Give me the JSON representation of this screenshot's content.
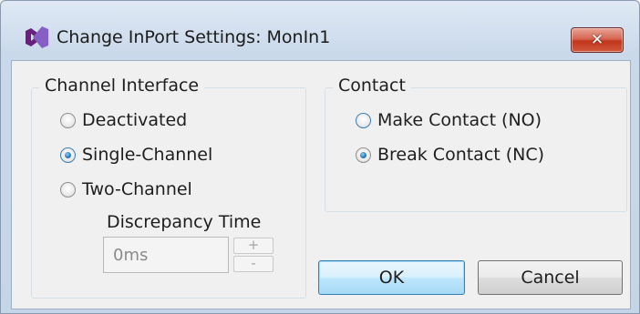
{
  "window": {
    "title": "Change InPort Settings: MonIn1",
    "close_glyph": "✕",
    "icon": "visual-studio-icon",
    "accent_icon_color": "#68217a"
  },
  "channel_interface": {
    "legend": "Channel Interface",
    "options": [
      {
        "label": "Deactivated",
        "checked": false
      },
      {
        "label": "Single-Channel",
        "checked": true
      },
      {
        "label": "Two-Channel",
        "checked": false
      }
    ],
    "discrepancy_time": {
      "label": "Discrepancy Time",
      "value": "0ms",
      "increment_glyph": "+",
      "decrement_glyph": "-"
    }
  },
  "contact": {
    "legend": "Contact",
    "options": [
      {
        "label": "Make Contact (NO)",
        "checked": false
      },
      {
        "label": "Break Contact (NC)",
        "checked": true
      }
    ]
  },
  "buttons": {
    "ok": "OK",
    "cancel": "Cancel"
  }
}
